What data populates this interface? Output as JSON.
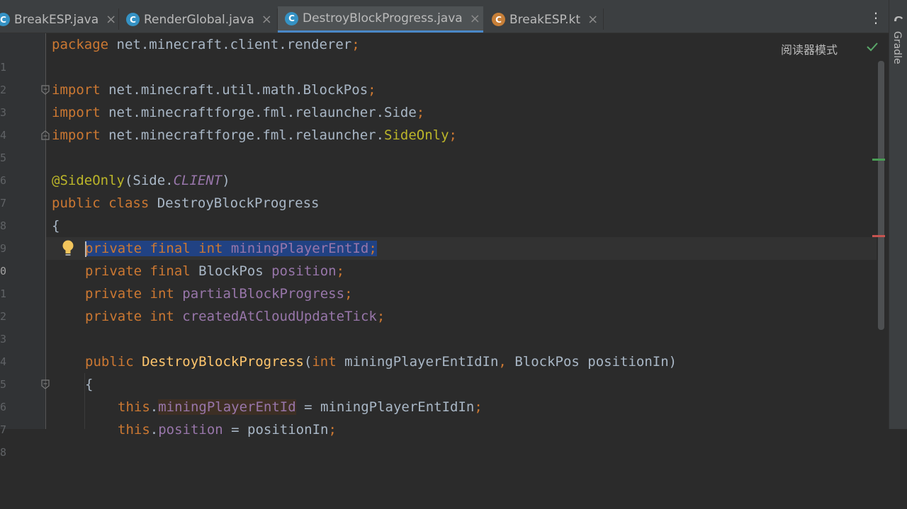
{
  "tabs": [
    {
      "name": "BreakESP.java",
      "icon": "C"
    },
    {
      "name": "RenderGlobal.java",
      "icon": "C"
    },
    {
      "name": "DestroyBlockProgress.java",
      "icon": "C",
      "active": true
    },
    {
      "name": "BreakESP.kt",
      "icon": "C"
    }
  ],
  "tab_close": "×",
  "more": "⋮",
  "side_panel": {
    "label": "Gradle"
  },
  "reader_mode": "阅读器模式",
  "line_numbers": [
    "1",
    "2",
    "3",
    "4",
    "5",
    "6",
    "7",
    "8",
    "9",
    "0",
    "1",
    "2",
    "3",
    "4",
    "5",
    "6",
    "7",
    "8"
  ],
  "code": {
    "l1": {
      "kw": "package",
      "rest": " net.minecraft.client.renderer",
      "semi": ";"
    },
    "l3": {
      "kw": "import",
      "rest": " net.minecraft.util.math.BlockPos",
      "semi": ";"
    },
    "l4": {
      "kw": "import",
      "rest": " net.minecraftforge.fml.relauncher.Side",
      "semi": ";"
    },
    "l5": {
      "kw": "import",
      "rest": " net.minecraftforge.fml.relauncher.",
      "ann": "SideOnly",
      "semi": ";"
    },
    "l7": {
      "ann": "@SideOnly",
      "p1": "(Side.",
      "fld": "CLIENT",
      "p2": ")"
    },
    "l8": {
      "kw": "public class",
      "rest": " DestroyBlockProgress"
    },
    "l9": {
      "text": "{"
    },
    "l10": {
      "kw": "private final int",
      "fld": " miningPlayerEntId",
      "semi": ";"
    },
    "l11": {
      "kw": "private final",
      "type": " BlockPos ",
      "fld": "position",
      "semi": ";"
    },
    "l12": {
      "kw": "private int",
      "fld": " partialBlockProgress",
      "semi": ";"
    },
    "l13": {
      "kw": "private int",
      "fld": " createdAtCloudUpdateTick",
      "semi": ";"
    },
    "l15": {
      "kw": "public",
      "mth": " DestroyBlockProgress",
      "p1": "(",
      "kw2": "int",
      "a1": " miningPlayerEntIdIn",
      "comma": ",",
      "a2": " BlockPos positionIn)"
    },
    "l16": {
      "text": "{"
    },
    "l17": {
      "kw": "this",
      "dot": ".",
      "fld": "miningPlayerEntId",
      "rest": " = miningPlayerEntIdIn",
      "semi": ";"
    },
    "l18": {
      "kw": "this",
      "dot": ".",
      "fld": "position",
      "rest": " = positionIn",
      "semi": ";"
    }
  },
  "colors": {
    "keyword": "#cc7832",
    "annotation": "#bbb529",
    "field": "#9876aa",
    "method": "#ffc66d",
    "text": "#a9b7c6",
    "accent": "#4a88c7"
  }
}
